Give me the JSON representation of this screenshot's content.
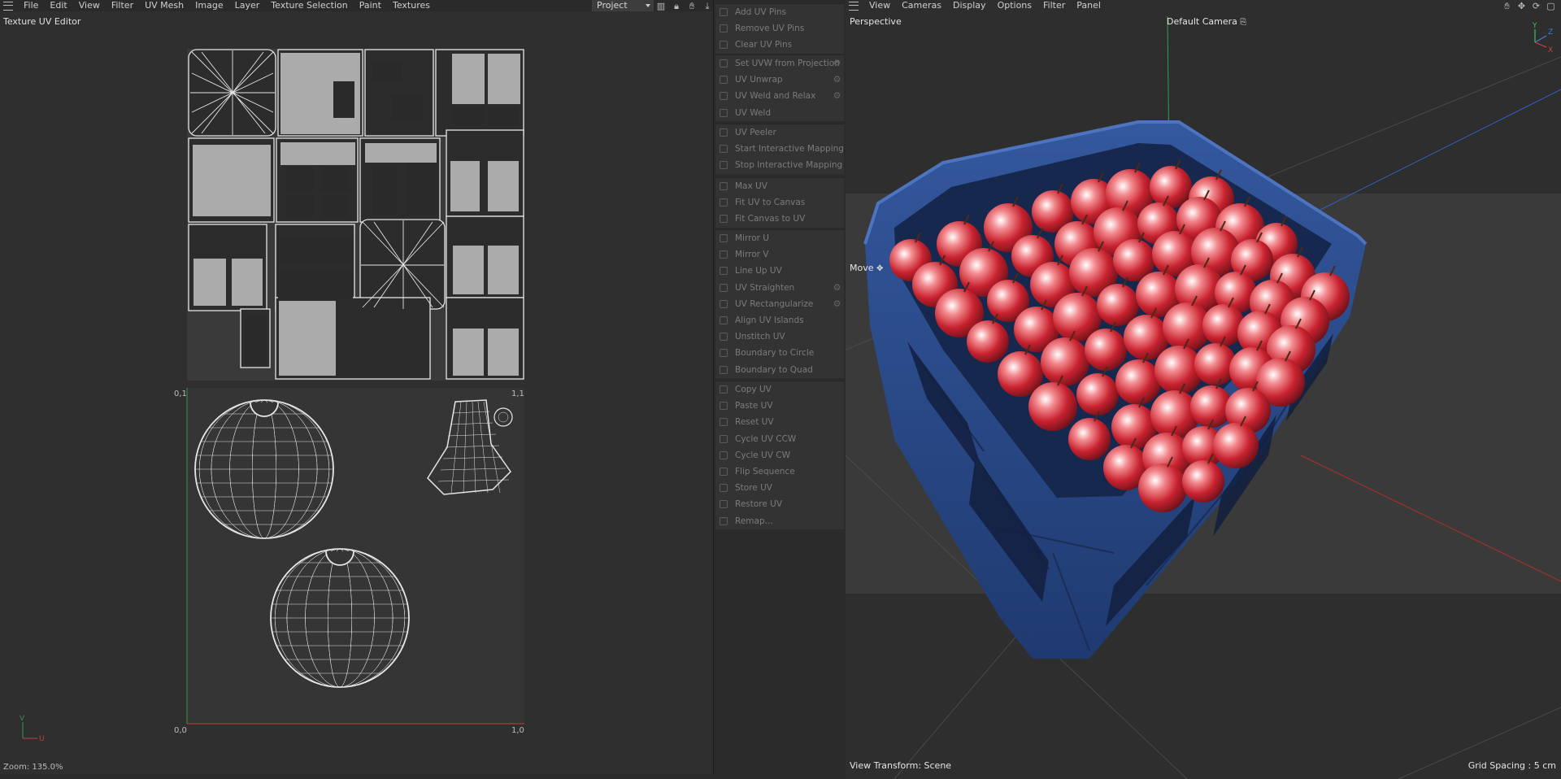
{
  "uv_editor": {
    "menu": [
      "File",
      "Edit",
      "View",
      "Filter",
      "UV Mesh",
      "Image",
      "Layer",
      "Texture Selection",
      "Paint",
      "Textures"
    ],
    "project_select": "Project",
    "title": "Texture UV Editor",
    "corner_labels": {
      "top_left": "0,1",
      "top_right": "1,1",
      "bottom_left": "0,0",
      "bottom_right": "1,0"
    },
    "axis_labels": {
      "v": "V",
      "u": "U"
    },
    "zoom": "Zoom: 135.0%"
  },
  "tools": {
    "groups": [
      {
        "items": [
          {
            "label": "Add UV Pins",
            "gear": false
          },
          {
            "label": "Remove UV Pins",
            "gear": false
          },
          {
            "label": "Clear UV Pins",
            "gear": false
          }
        ]
      },
      {
        "items": [
          {
            "label": "Set UVW from Projection",
            "gear": true
          },
          {
            "label": "UV Unwrap",
            "gear": true
          },
          {
            "label": "UV Weld and Relax",
            "gear": true
          },
          {
            "label": "UV Weld",
            "gear": false
          }
        ]
      },
      {
        "items": [
          {
            "label": "UV Peeler",
            "gear": false
          },
          {
            "label": "Start Interactive Mapping",
            "gear": false
          },
          {
            "label": "Stop Interactive Mapping",
            "gear": false
          }
        ]
      },
      {
        "items": [
          {
            "label": "Max UV",
            "gear": false
          },
          {
            "label": "Fit UV to Canvas",
            "gear": false
          },
          {
            "label": "Fit Canvas to UV",
            "gear": false
          }
        ]
      },
      {
        "items": [
          {
            "label": "Mirror U",
            "gear": false
          },
          {
            "label": "Mirror V",
            "gear": false
          },
          {
            "label": "Line Up UV",
            "gear": false
          },
          {
            "label": "UV Straighten",
            "gear": true
          },
          {
            "label": "UV Rectangularize",
            "gear": true
          },
          {
            "label": "Align UV Islands",
            "gear": false
          },
          {
            "label": "Unstitch UV",
            "gear": false
          },
          {
            "label": "Boundary to Circle",
            "gear": false
          },
          {
            "label": "Boundary to Quad",
            "gear": false
          }
        ]
      },
      {
        "items": [
          {
            "label": "Copy UV",
            "gear": false
          },
          {
            "label": "Paste UV",
            "gear": false
          },
          {
            "label": "Reset UV",
            "gear": false
          },
          {
            "label": "Cycle UV CCW",
            "gear": false
          },
          {
            "label": "Cycle UV CW",
            "gear": false
          },
          {
            "label": "Flip Sequence",
            "gear": false
          },
          {
            "label": "Store UV",
            "gear": false
          },
          {
            "label": "Restore UV",
            "gear": false
          },
          {
            "label": "Remap...",
            "gear": false
          }
        ]
      }
    ]
  },
  "viewport": {
    "menu": [
      "View",
      "Cameras",
      "Display",
      "Options",
      "Filter",
      "Panel"
    ],
    "view_name": "Perspective",
    "camera": "Default Camera",
    "move_label": "Move",
    "view_transform": "View Transform: Scene",
    "grid_spacing": "Grid Spacing : 5 cm",
    "axis_gizmo": {
      "y": "Y",
      "z": "Z",
      "x": "X"
    }
  },
  "colors": {
    "crate_blue": "#2d4f94",
    "fruit_red": "#c8222f",
    "uv_wire": "#e6e6e6",
    "u_axis": "#c0403a",
    "v_axis": "#3f8f4a"
  }
}
